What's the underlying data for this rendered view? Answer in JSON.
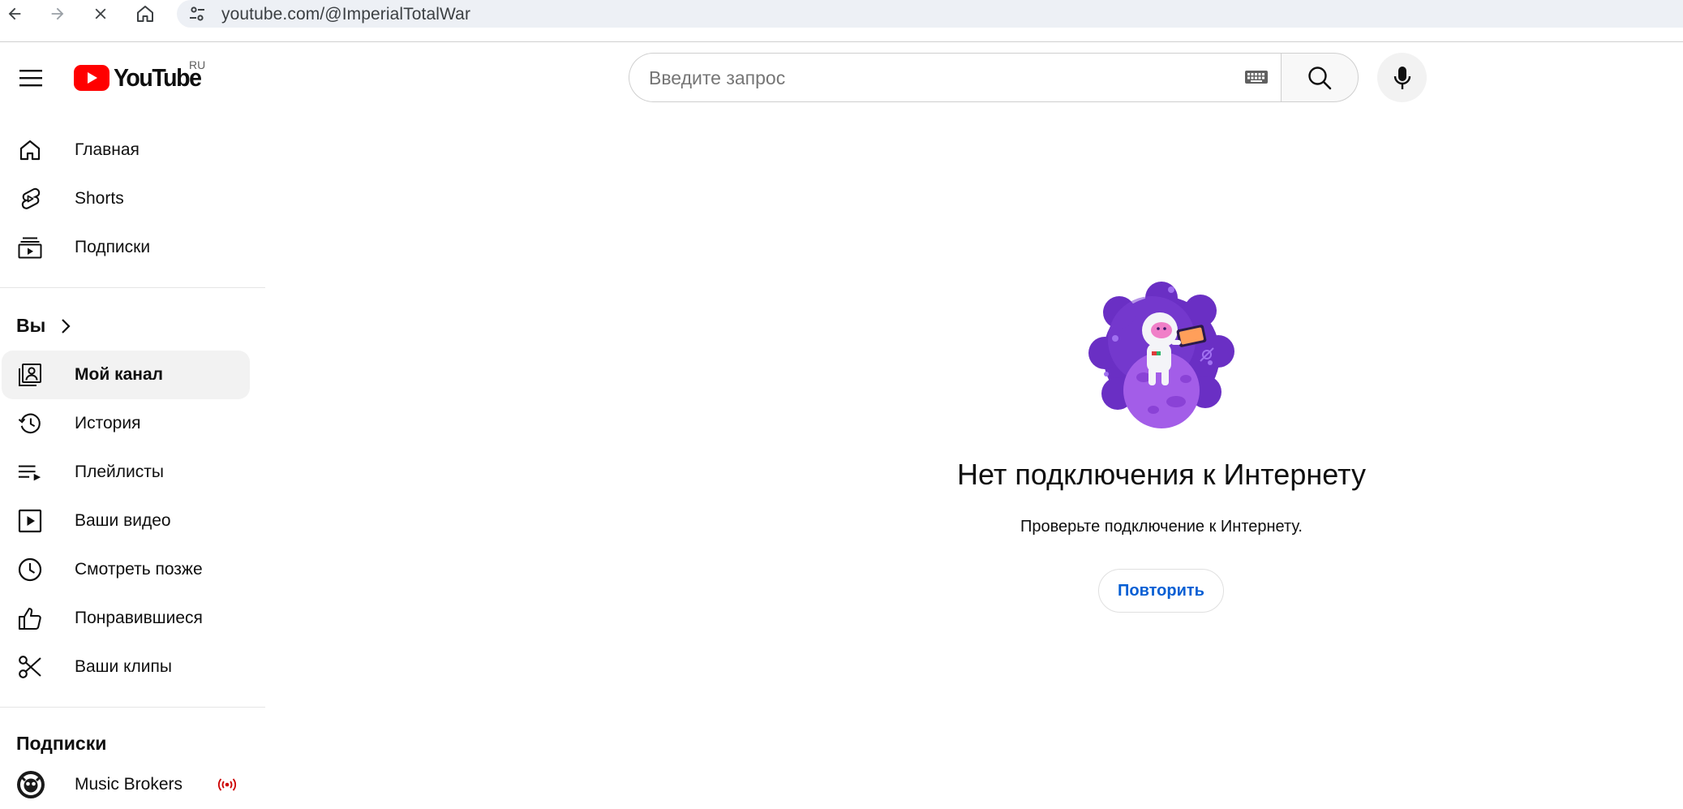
{
  "browser": {
    "url": "youtube.com/@ImperialTotalWar",
    "nav": [
      "back-icon",
      "forward-icon",
      "stop-icon",
      "home-icon",
      "site-info-icon"
    ]
  },
  "masthead": {
    "logo_text": "YouTube",
    "region": "RU",
    "search_placeholder": "Введите запрос",
    "search_value": "",
    "brand_red": "#ff0000"
  },
  "sidebar": {
    "main": [
      {
        "label": "Главная",
        "icon": "home-icon"
      },
      {
        "label": "Shorts",
        "icon": "shorts-icon"
      },
      {
        "label": "Подписки",
        "icon": "subscriptions-icon"
      }
    ],
    "you_header": "Вы",
    "you": [
      {
        "label": "Мой канал",
        "icon": "my-channel-icon",
        "active": true
      },
      {
        "label": "История",
        "icon": "history-icon"
      },
      {
        "label": "Плейлисты",
        "icon": "playlists-icon"
      },
      {
        "label": "Ваши видео",
        "icon": "your-videos-icon"
      },
      {
        "label": "Смотреть позже",
        "icon": "watch-later-icon"
      },
      {
        "label": "Понравившиеся",
        "icon": "liked-icon"
      },
      {
        "label": "Ваши клипы",
        "icon": "clips-icon"
      }
    ],
    "subscriptions_header": "Подписки",
    "subscriptions": [
      {
        "label": "Music Brokers",
        "icon": "channel-avatar",
        "live": true,
        "live_color": "#cc0000"
      }
    ]
  },
  "main": {
    "title": "Нет подключения к Интернету",
    "subtitle": "Проверьте подключение к Интернету.",
    "retry_label": "Повторить",
    "accent": "#065fd4"
  }
}
